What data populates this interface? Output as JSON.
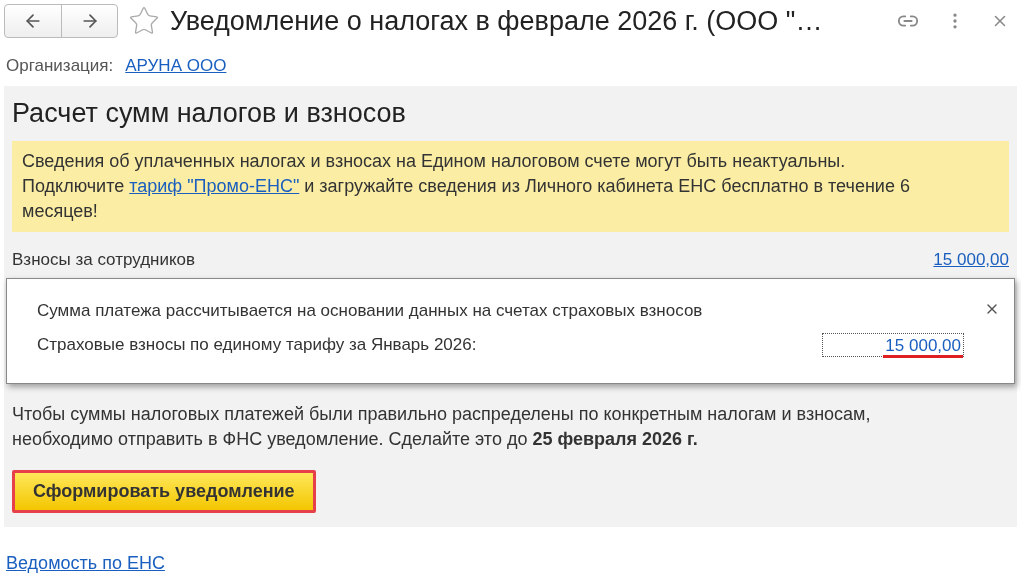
{
  "window": {
    "title": "Уведомление о налогах в феврале 2026 г. (ООО \"…",
    "favorite": false
  },
  "organization": {
    "label": "Организация:",
    "value": "АРУНА ООО"
  },
  "panel": {
    "title": "Расчет сумм налогов и взносов",
    "notice": {
      "text_before": "Сведения об уплаченных налогах и взносах на Едином налоговом счете могут быть неактуальны. Подключите ",
      "link": "тариф \"Промо-ЕНС\"",
      "text_after": " и загружайте сведения из Личного кабинета ЕНС бесплатно в течение 6 месяцев!"
    },
    "row": {
      "label": "Взносы за сотрудников",
      "amount": "15 000,00"
    },
    "popup": {
      "note": "Сумма платежа рассчитывается на основании данных на счетах страховых взносов",
      "label": "Страховые взносы по единому тарифу за Январь 2026:",
      "amount": "15 000,00",
      "highlighted": true
    },
    "info": "Чтобы суммы налоговых платежей были правильно распределены по конкретным налогам и взносам, необходимо отправить в ФНС уведомление. Сделайте это до **25 февраля 2026 г.**",
    "button": {
      "label": "Сформировать уведомление",
      "highlighted": true
    }
  },
  "footer_link": "Ведомость по ЕНС"
}
